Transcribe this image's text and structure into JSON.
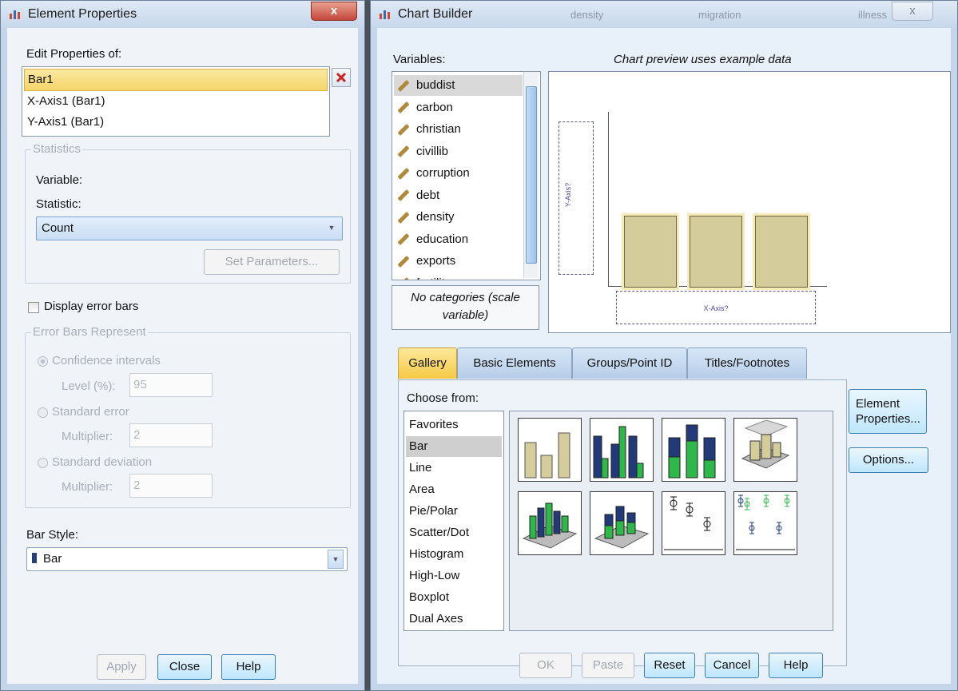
{
  "element_properties": {
    "window_title": "Element Properties",
    "close_label": "x",
    "edit_properties_label": "Edit Properties of:",
    "edit_items": [
      "Bar1",
      "X-Axis1 (Bar1)",
      "Y-Axis1 (Bar1)"
    ],
    "statistics_legend": "Statistics",
    "variable_label": "Variable:",
    "statistic_label": "Statistic:",
    "statistic_value": "Count",
    "set_parameters_label": "Set Parameters...",
    "display_error_bars_label": "Display error bars",
    "error_bars_legend": "Error Bars Represent",
    "confidence_intervals_label": "Confidence intervals",
    "level_label": "Level (%):",
    "level_value": "95",
    "standard_error_label": "Standard error",
    "se_multiplier_label": "Multiplier:",
    "se_multiplier_value": "2",
    "standard_deviation_label": "Standard deviation",
    "sd_multiplier_label": "Multiplier:",
    "sd_multiplier_value": "2",
    "bar_style_label": "Bar Style:",
    "bar_style_value": "Bar",
    "buttons": {
      "apply": "Apply",
      "close": "Close",
      "help": "Help"
    }
  },
  "chart_builder": {
    "window_title": "Chart Builder",
    "close_label": "x",
    "bg_tabs": [
      "density",
      "migration",
      "illness"
    ],
    "variables_label": "Variables:",
    "preview_note": "Chart preview uses example data",
    "variables": [
      "buddist",
      "carbon",
      "christian",
      "civillib",
      "corruption",
      "debt",
      "density",
      "education",
      "exports",
      "fertility"
    ],
    "no_categories_text": "No categories (scale variable)",
    "y_axis_drop": "Y-Axis?",
    "x_axis_drop": "X-Axis?",
    "tabs": [
      "Gallery",
      "Basic Elements",
      "Groups/Point ID",
      "Titles/Footnotes"
    ],
    "choose_from_label": "Choose from:",
    "choose_items": [
      "Favorites",
      "Bar",
      "Line",
      "Area",
      "Pie/Polar",
      "Scatter/Dot",
      "Histogram",
      "High-Low",
      "Boxplot",
      "Dual Axes"
    ],
    "side_buttons": {
      "element_properties": "Element Properties...",
      "options": "Options..."
    },
    "buttons": {
      "ok": "OK",
      "paste": "Paste",
      "reset": "Reset",
      "cancel": "Cancel",
      "help": "Help"
    }
  },
  "colors": {
    "selection": "#f5d56a",
    "bar_fill": "#d4cc9a",
    "accent": "#3c7fb1"
  }
}
